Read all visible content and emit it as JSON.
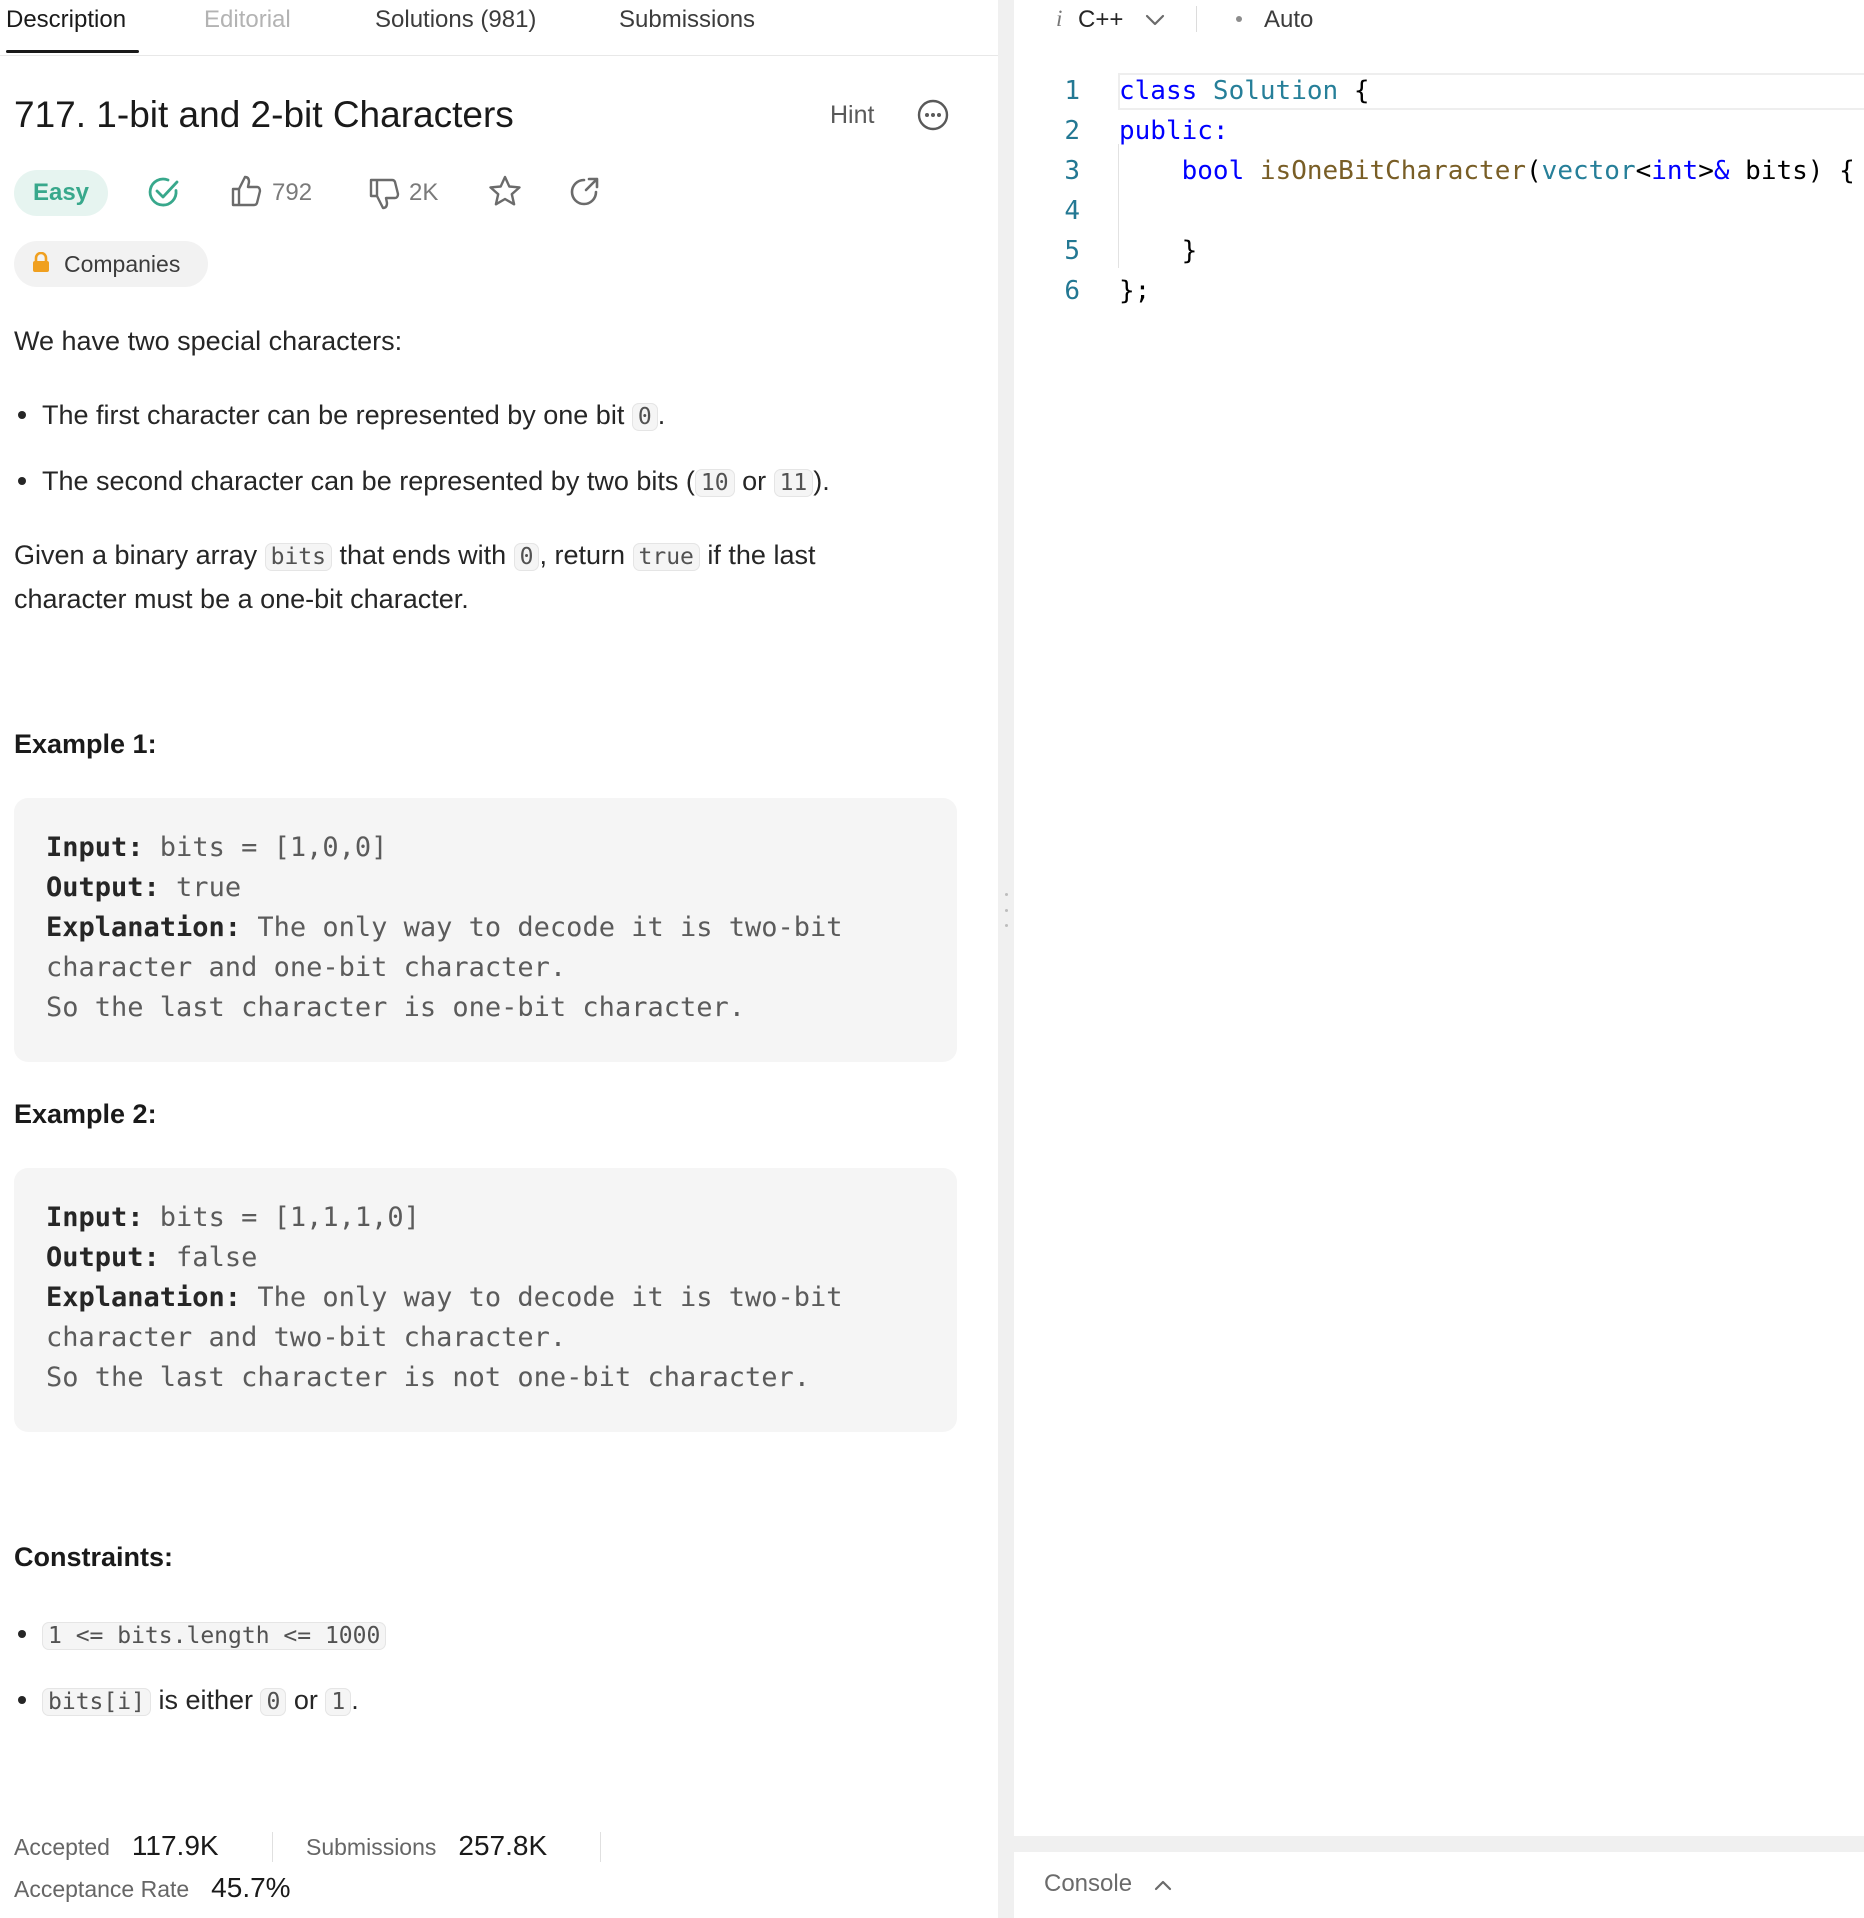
{
  "tabs": {
    "description": "Description",
    "editorial": "Editorial",
    "solutions": "Solutions (981)",
    "submissions": "Submissions"
  },
  "problem": {
    "title": "717. 1-bit and 2-bit Characters",
    "hint": "Hint",
    "difficulty": "Easy",
    "likes": "792",
    "dislikes": "2K",
    "companies": "Companies",
    "intro": "We have two special characters:",
    "bullet1_text": "The first character can be represented by one bit ",
    "bullet1_code": "0",
    "bullet1_end": ".",
    "bullet2_text": "The second character can be represented by two bits (",
    "bullet2_code1": "10",
    "bullet2_or": " or ",
    "bullet2_code2": "11",
    "bullet2_end": ").",
    "task_p1": "Given a binary array ",
    "task_code1": "bits",
    "task_p2": " that ends with ",
    "task_code2": "0",
    "task_p3": ", return ",
    "task_code3": "true",
    "task_p4": " if the last",
    "task_line2": "character must be a one-bit character."
  },
  "examples": [
    {
      "heading": "Example 1:",
      "input_label": "Input:",
      "input": " bits = [1,0,0]",
      "output_label": "Output:",
      "output": " true",
      "expl_label": "Explanation:",
      "expl1": " The only way to decode it is two-bit",
      "expl2": "character and one-bit character.",
      "expl3": "So the last character is one-bit character."
    },
    {
      "heading": "Example 2:",
      "input_label": "Input:",
      "input": " bits = [1,1,1,0]",
      "output_label": "Output:",
      "output": " false",
      "expl_label": "Explanation:",
      "expl1": " The only way to decode it is two-bit",
      "expl2": "character and two-bit character.",
      "expl3": "So the last character is not one-bit character."
    }
  ],
  "constraints": {
    "heading": "Constraints:",
    "c1_code": "1 <= bits.length <= 1000",
    "c2_code": "bits[i]",
    "c2_text": " is either ",
    "c2_code2": "0",
    "c2_or": " or ",
    "c2_code3": "1",
    "c2_end": "."
  },
  "stats": {
    "accepted_label": "Accepted",
    "accepted": "117.9K",
    "submissions_label": "Submissions",
    "submissions": "257.8K",
    "rate_label": "Acceptance Rate",
    "rate": "45.7%"
  },
  "editor": {
    "language": "C++",
    "mode": "Auto",
    "line_numbers": [
      "1",
      "2",
      "3",
      "4",
      "5",
      "6"
    ],
    "code": {
      "l1_kw": "class",
      "l1_ty": " Solution",
      "l1_rest": " {",
      "l2_kw": "public:",
      "l3_indent": "    ",
      "l3_kw": "bool",
      "l3_fn": " isOneBitCharacter",
      "l3_p1": "(",
      "l3_ty": "vector",
      "l3_lt": "<",
      "l3_kw2": "int",
      "l3_gt": ">",
      "l3_amp": "&",
      "l3_rest": " bits) {",
      "l5": "    }",
      "l6": "};"
    },
    "console": "Console"
  },
  "colors": {
    "easy": "#38a88c",
    "accepted_check": "#38a88c",
    "keyword": "#0000ff",
    "type": "#267f99",
    "function": "#795e26",
    "line_number": "#237893",
    "lock": "#f0a020"
  },
  "icons": [
    "more-icon",
    "check-circle-icon",
    "thumbs-up-icon",
    "thumbs-down-icon",
    "star-icon",
    "share-icon",
    "lock-icon",
    "chevron-down-icon",
    "chevron-up-icon"
  ]
}
